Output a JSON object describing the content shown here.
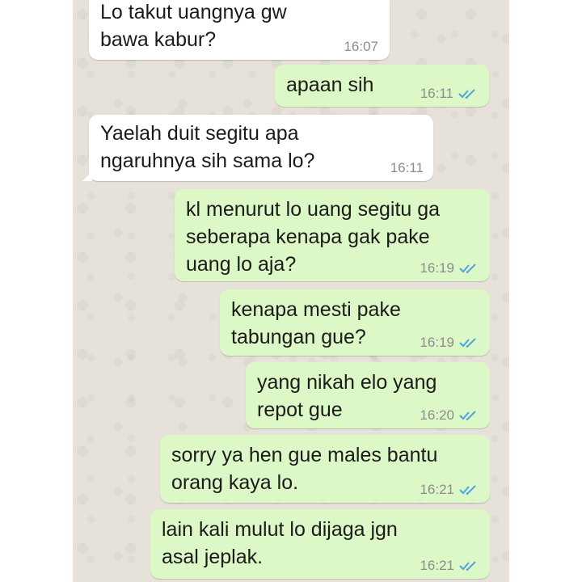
{
  "conversation": {
    "messages": [
      {
        "direction": "in",
        "text": "Lo takut uangnya gw\nbawa kabur?",
        "time": "16:07"
      },
      {
        "direction": "out",
        "text": "apaan sih",
        "time": "16:11",
        "status": "read"
      },
      {
        "direction": "in",
        "text": "Yaelah duit segitu apa\nngaruhnya sih sama lo?",
        "time": "16:11"
      },
      {
        "direction": "out",
        "text": "kl menurut lo uang segitu ga\nseberapa kenapa gak pake\nuang lo aja?",
        "time": "16:19",
        "status": "read"
      },
      {
        "direction": "out",
        "text": "kenapa mesti pake\ntabungan gue?",
        "time": "16:19",
        "status": "read"
      },
      {
        "direction": "out",
        "text": "yang nikah elo yang\nrepot gue",
        "time": "16:20",
        "status": "read"
      },
      {
        "direction": "out",
        "text": "sorry ya hen gue males bantu\norang kaya lo.",
        "time": "16:21",
        "status": "read"
      },
      {
        "direction": "out",
        "text": "lain kali mulut lo dijaga jgn\nasal jeplak.",
        "time": "16:21",
        "status": "read"
      }
    ]
  },
  "colors": {
    "incoming_bubble": "#ffffff",
    "outgoing_bubble": "#dcf8c6",
    "chat_background": "#e6e2da",
    "read_ticks": "#4fa3e0",
    "timestamp": "#8c8c8c"
  },
  "icons": {
    "read_status": "double-check-icon"
  }
}
